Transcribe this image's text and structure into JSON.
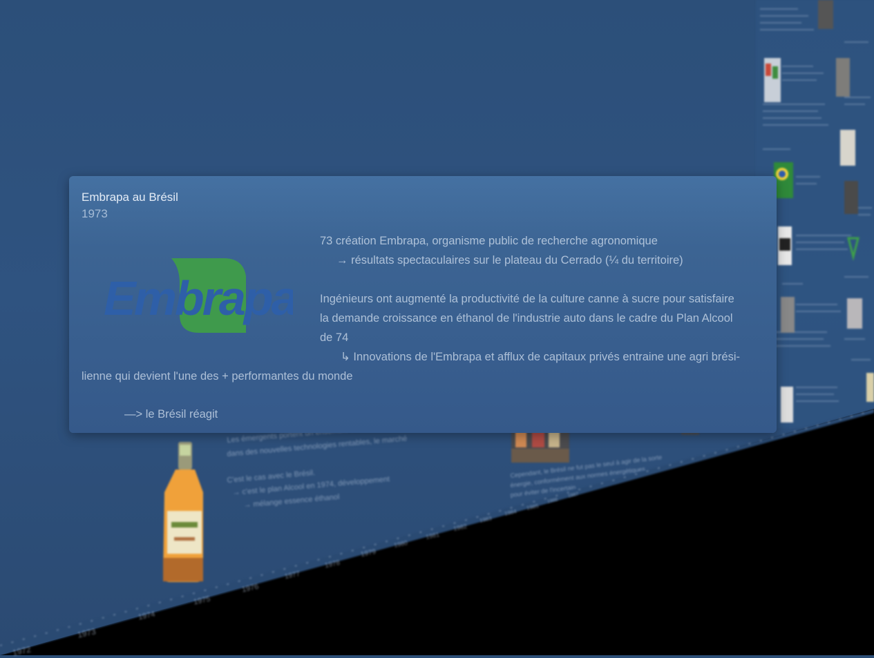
{
  "card": {
    "title": "Embrapa au Brésil",
    "year": "1973",
    "logo_text": "Embrapa",
    "line1": "73 création Embrapa, organisme public de recherche agronomique",
    "line2": "→ résultats spectaculaires sur le plateau du Cerrado (¼ du territoire)",
    "line3": "Ingénieurs ont augmenté la productivité de la culture canne à sucre pour satisfaire",
    "line4": "la demande croissance en éthanol de l'industrie auto dans le cadre du Plan Alcool",
    "line5": "de 74",
    "line6": "↳ Innovations de l'Embrapa et afflux de capitaux privés entraine une agri brési-",
    "line7": "lienne qui devient l'une des + performantes du monde",
    "line8": "—> le Brésil réagit"
  },
  "timeline": {
    "years": [
      "1972",
      "1973",
      "1974",
      "1975",
      "1976",
      "1977",
      "1978",
      "1979",
      "1980",
      "1981",
      "1982",
      "1983",
      "1984",
      "1985",
      "1986",
      "1987"
    ]
  },
  "colors": {
    "background": "#2c4e77",
    "card": "#3c6493",
    "embrapa_blue": "#2e5fa8",
    "embrapa_green": "#3f9a4c"
  }
}
